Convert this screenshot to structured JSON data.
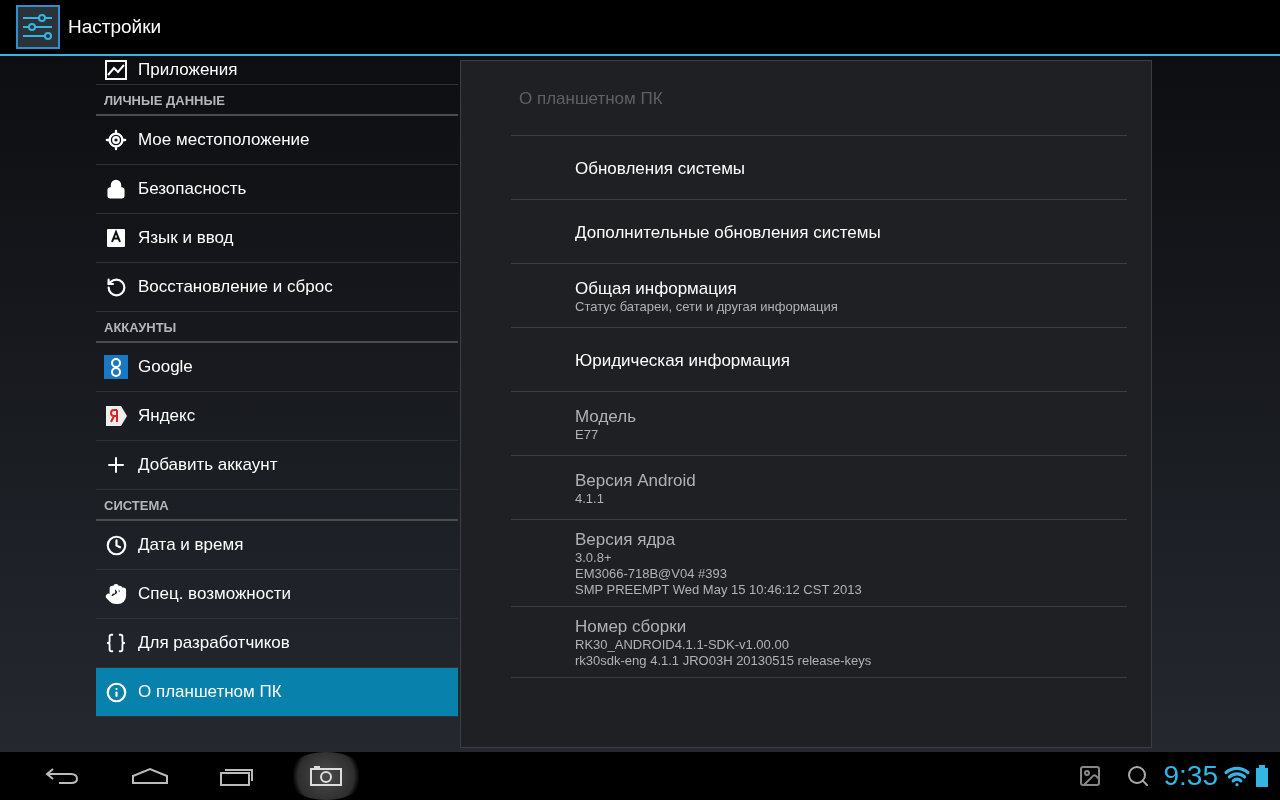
{
  "action_bar": {
    "title": "Настройки"
  },
  "sidebar": {
    "items": [
      {
        "kind": "item",
        "label": "Приложения",
        "selected": false
      },
      {
        "kind": "header",
        "label": "ЛИЧНЫЕ ДАННЫЕ"
      },
      {
        "kind": "item",
        "label": "Мое местоположение",
        "selected": false
      },
      {
        "kind": "item",
        "label": "Безопасность",
        "selected": false
      },
      {
        "kind": "item",
        "label": "Язык и ввод",
        "selected": false
      },
      {
        "kind": "item",
        "label": "Восстановление и сброс",
        "selected": false
      },
      {
        "kind": "header",
        "label": "АККАУНТЫ"
      },
      {
        "kind": "item",
        "label": "Google",
        "selected": false
      },
      {
        "kind": "item",
        "label": "Яндекс",
        "selected": false
      },
      {
        "kind": "item",
        "label": "Добавить аккаунт",
        "selected": false
      },
      {
        "kind": "header",
        "label": "СИСТЕМА"
      },
      {
        "kind": "item",
        "label": "Дата и время",
        "selected": false
      },
      {
        "kind": "item",
        "label": "Спец. возможности",
        "selected": false
      },
      {
        "kind": "item",
        "label": "Для разработчиков",
        "selected": false
      },
      {
        "kind": "item",
        "label": "О планшетном ПК",
        "selected": true
      }
    ]
  },
  "detail": {
    "title": "О планшетном ПК",
    "rows": [
      {
        "kind": "action",
        "title": "Обновления системы"
      },
      {
        "kind": "action",
        "title": "Дополнительные обновления системы"
      },
      {
        "kind": "action",
        "title": "Общая информация",
        "summary": [
          "Статус батареи, сети и другая информация"
        ]
      },
      {
        "kind": "action",
        "title": "Юридическая информация"
      },
      {
        "kind": "info",
        "title": "Модель",
        "summary": [
          "E77"
        ]
      },
      {
        "kind": "info",
        "title": "Версия Android",
        "summary": [
          "4.1.1"
        ]
      },
      {
        "kind": "info",
        "title": "Версия ядра",
        "summary": [
          "3.0.8+",
          "EM3066-718B@V04 #393",
          "SMP PREEMPT Wed May 15 10:46:12 CST 2013"
        ]
      },
      {
        "kind": "info",
        "title": "Номер сборки",
        "summary": [
          "RK30_ANDROID4.1.1-SDK-v1.00.00",
          "rk30sdk-eng 4.1.1 JRO03H 20130515 release-keys"
        ]
      }
    ]
  },
  "nav_bar": {
    "buttons": [
      {
        "pressed": false
      },
      {
        "pressed": false
      },
      {
        "pressed": false
      },
      {
        "pressed": true
      }
    ],
    "time": "9:35"
  }
}
